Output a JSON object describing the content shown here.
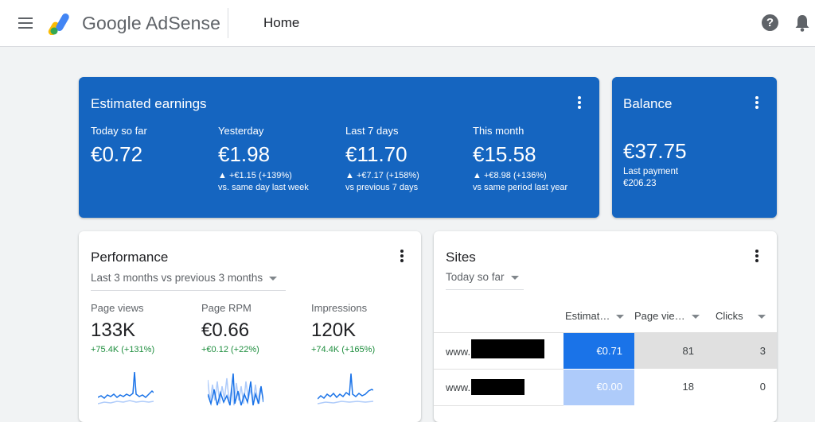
{
  "header": {
    "brand": "Google AdSense",
    "page_title": "Home",
    "help_glyph": "?"
  },
  "estimated_earnings": {
    "title": "Estimated earnings",
    "metrics": [
      {
        "label": "Today so far",
        "value": "€0.72",
        "delta": "",
        "compare": ""
      },
      {
        "label": "Yesterday",
        "value": "€1.98",
        "delta": "▲ +€1.15 (+139%)",
        "compare": "vs. same day last week"
      },
      {
        "label": "Last 7 days",
        "value": "€11.70",
        "delta": "▲ +€7.17 (+158%)",
        "compare": "vs previous 7 days"
      },
      {
        "label": "This month",
        "value": "€15.58",
        "delta": "▲ +€8.98 (+136%)",
        "compare": "vs same period last year"
      }
    ]
  },
  "balance": {
    "title": "Balance",
    "value": "€37.75",
    "last_payment_label": "Last payment",
    "last_payment_value": "€206.23"
  },
  "performance": {
    "title": "Performance",
    "range": "Last 3 months vs previous 3 months",
    "metrics": [
      {
        "label": "Page views",
        "value": "133K",
        "delta": "+75.4K (+131%)"
      },
      {
        "label": "Page RPM",
        "value": "€0.66",
        "delta": "+€0.12 (+22%)"
      },
      {
        "label": "Impressions",
        "value": "120K",
        "delta": "+74.4K (+165%)"
      }
    ]
  },
  "sites": {
    "title": "Sites",
    "range": "Today so far",
    "columns": [
      "Estimat…",
      "Page vie…",
      "Clicks"
    ],
    "rows": [
      {
        "site": "www.",
        "earnings": "€0.71",
        "page_views": "81",
        "clicks": "3"
      },
      {
        "site": "www.",
        "earnings": "€0.00",
        "page_views": "18",
        "clicks": "0"
      }
    ]
  },
  "colors": {
    "accent_blue": "#1565c0",
    "positive_green": "#1e8e3e",
    "highlight_cell": "#1a73e8",
    "light_cell": "#aecbfa"
  },
  "icons": [
    "menu-icon",
    "adsense-logo",
    "help-icon",
    "bell-icon",
    "more-vert-icon",
    "dropdown-caret-icon"
  ]
}
